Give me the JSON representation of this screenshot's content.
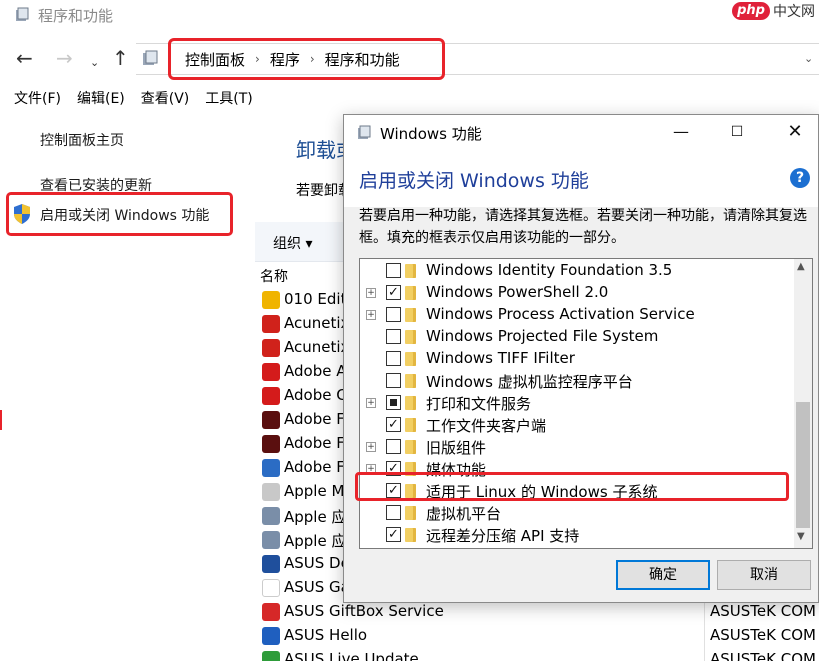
{
  "window": {
    "title": "程序和功能"
  },
  "watermark": {
    "badge": "php",
    "text": "中文网"
  },
  "nav": {
    "back": "←",
    "forward": "→",
    "recent": "⌄",
    "up": "↑",
    "dropdown": "⌄"
  },
  "breadcrumb": [
    "控制面板",
    "程序",
    "程序和功能"
  ],
  "breadcrumb_sep": "›",
  "menu": [
    "文件(F)",
    "编辑(E)",
    "查看(V)",
    "工具(T)"
  ],
  "sidebar": {
    "home": "控制面板主页",
    "updates": "查看已安装的更新",
    "features": "启用或关闭 Windows 功能"
  },
  "main": {
    "title": "卸载或",
    "desc": "若要卸载",
    "organize": "组织 ▾",
    "col_name": "名称"
  },
  "programs": [
    {
      "name": "010 Edit",
      "publisher": "",
      "color": "#f0b400"
    },
    {
      "name": "Acunetix",
      "publisher": "",
      "color": "#d0221b"
    },
    {
      "name": "Acunetix",
      "publisher": "",
      "color": "#d0221b"
    },
    {
      "name": "Adobe A",
      "publisher": "",
      "color": "#d41b1b"
    },
    {
      "name": "Adobe C",
      "publisher": "",
      "color": "#d41b1b"
    },
    {
      "name": "Adobe F",
      "publisher": "",
      "color": "#5a0f0f"
    },
    {
      "name": "Adobe F",
      "publisher": "",
      "color": "#5a0f0f"
    },
    {
      "name": "Adobe F",
      "publisher": "",
      "color": "#2b6cc4"
    },
    {
      "name": "Apple M",
      "publisher": "",
      "color": "#c8c8c8"
    },
    {
      "name": "Apple 应",
      "publisher": "",
      "color": "#7a8ea8"
    },
    {
      "name": "Apple 应",
      "publisher": "",
      "color": "#7a8ea8"
    },
    {
      "name": "ASUS De",
      "publisher": "",
      "color": "#1f4f9c"
    },
    {
      "name": "ASUS Ga",
      "publisher": "",
      "color": "#ffffff"
    },
    {
      "name": "ASUS GiftBox Service",
      "publisher": "ASUSTeK COM",
      "color": "#d62828"
    },
    {
      "name": "ASUS Hello",
      "publisher": "ASUSTeK COM",
      "color": "#1f5fbf"
    },
    {
      "name": "ASUS Live Update",
      "publisher": "ASUSTeK COM",
      "color": "#2e9c3a"
    }
  ],
  "dialog": {
    "title": "Windows 功能",
    "minimize": "—",
    "maximize": "☐",
    "close": "✕",
    "heading": "启用或关闭 Windows 功能",
    "help": "?",
    "description": "若要启用一种功能，请选择其复选框。若要关闭一种功能，请清除其复选框。填充的框表示仅启用该功能的一部分。",
    "ok": "确定",
    "cancel": "取消"
  },
  "features": [
    {
      "label": "Windows Identity Foundation 3.5",
      "state": "unchecked",
      "expandable": false
    },
    {
      "label": "Windows PowerShell 2.0",
      "state": "checked",
      "expandable": true
    },
    {
      "label": "Windows Process Activation Service",
      "state": "unchecked",
      "expandable": true
    },
    {
      "label": "Windows Projected File System",
      "state": "unchecked",
      "expandable": false
    },
    {
      "label": "Windows TIFF IFilter",
      "state": "unchecked",
      "expandable": false
    },
    {
      "label": "Windows 虚拟机监控程序平台",
      "state": "unchecked",
      "expandable": false
    },
    {
      "label": "打印和文件服务",
      "state": "partial",
      "expandable": true
    },
    {
      "label": "工作文件夹客户端",
      "state": "checked",
      "expandable": false
    },
    {
      "label": "旧版组件",
      "state": "unchecked",
      "expandable": true
    },
    {
      "label": "媒体功能",
      "state": "checked",
      "expandable": true
    },
    {
      "label": "适用于 Linux 的 Windows 子系统",
      "state": "checked",
      "expandable": false
    },
    {
      "label": "虚拟机平台",
      "state": "unchecked",
      "expandable": false
    },
    {
      "label": "远程差分压缩 API 支持",
      "state": "checked",
      "expandable": false
    }
  ],
  "check_glyph": "✓",
  "expander_glyph": "+",
  "scroll": {
    "up": "▲",
    "down": "▼"
  },
  "accent": "#e8232a"
}
